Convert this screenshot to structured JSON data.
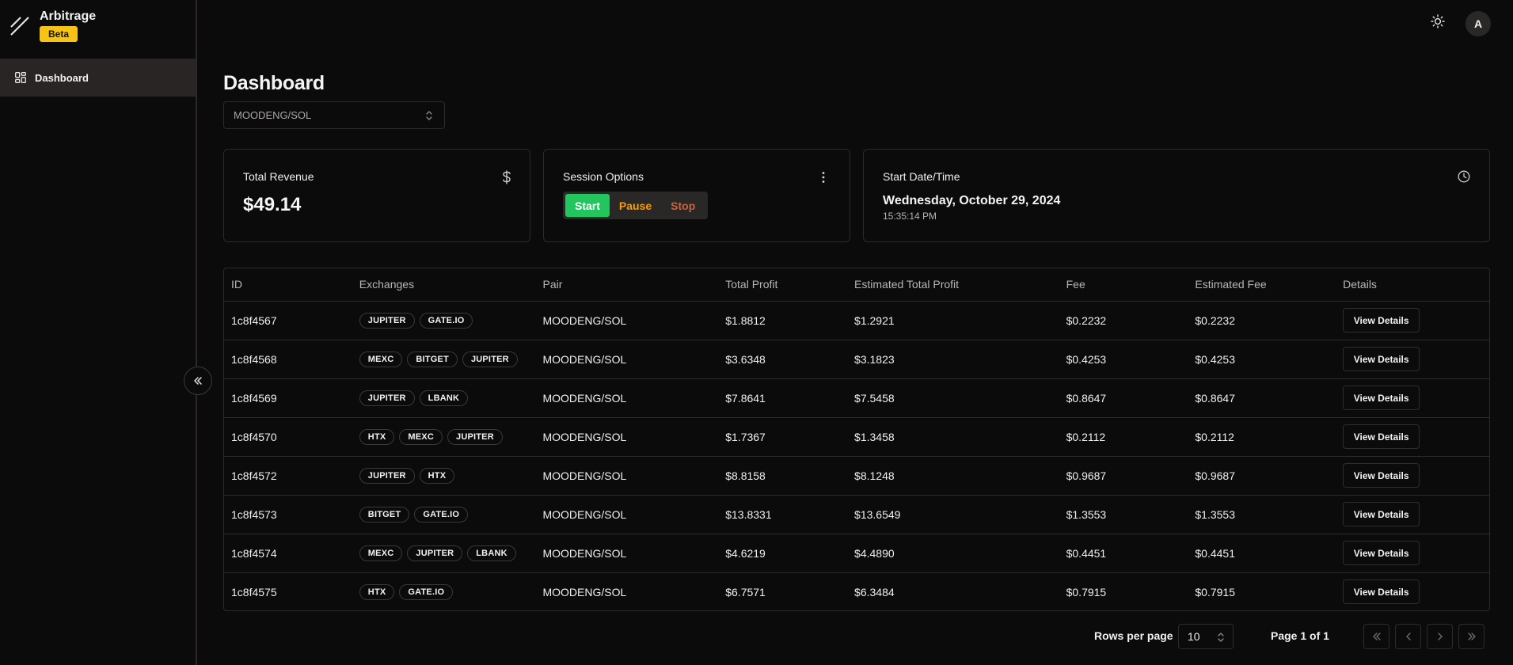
{
  "brand": {
    "title": "Arbitrage",
    "badge": "Beta"
  },
  "sidebar": {
    "items": [
      {
        "label": "Dashboard",
        "icon": "dashboard-icon"
      }
    ]
  },
  "header": {
    "avatar_initial": "A"
  },
  "page": {
    "title": "Dashboard",
    "pair_selected": "MOODENG/SOL"
  },
  "cards": {
    "revenue": {
      "title": "Total Revenue",
      "value": "$49.14",
      "icon": "dollar-icon"
    },
    "session": {
      "title": "Session Options",
      "start": "Start",
      "pause": "Pause",
      "stop": "Stop",
      "icon": "more-vertical-icon"
    },
    "start_date": {
      "title": "Start Date/Time",
      "date": "Wednesday, October 29, 2024",
      "time": "15:35:14 PM",
      "icon": "clock-icon"
    }
  },
  "table": {
    "columns": [
      "ID",
      "Exchanges",
      "Pair",
      "Total Profit",
      "Estimated Total Profit",
      "Fee",
      "Estimated Fee",
      "Details"
    ],
    "details_label": "View Details",
    "rows": [
      {
        "id": "1c8f4567",
        "exchanges": [
          "JUPITER",
          "GATE.IO"
        ],
        "pair": "MOODENG/SOL",
        "total_profit": "$1.8812",
        "est_total_profit": "$1.2921",
        "fee": "$0.2232",
        "est_fee": "$0.2232"
      },
      {
        "id": "1c8f4568",
        "exchanges": [
          "MEXC",
          "BITGET",
          "JUPITER"
        ],
        "pair": "MOODENG/SOL",
        "total_profit": "$3.6348",
        "est_total_profit": "$3.1823",
        "fee": "$0.4253",
        "est_fee": "$0.4253"
      },
      {
        "id": "1c8f4569",
        "exchanges": [
          "JUPITER",
          "LBANK"
        ],
        "pair": "MOODENG/SOL",
        "total_profit": "$7.8641",
        "est_total_profit": "$7.5458",
        "fee": "$0.8647",
        "est_fee": "$0.8647"
      },
      {
        "id": "1c8f4570",
        "exchanges": [
          "HTX",
          "MEXC",
          "JUPITER"
        ],
        "pair": "MOODENG/SOL",
        "total_profit": "$1.7367",
        "est_total_profit": "$1.3458",
        "fee": "$0.2112",
        "est_fee": "$0.2112"
      },
      {
        "id": "1c8f4572",
        "exchanges": [
          "JUPITER",
          "HTX"
        ],
        "pair": "MOODENG/SOL",
        "total_profit": "$8.8158",
        "est_total_profit": "$8.1248",
        "fee": "$0.9687",
        "est_fee": "$0.9687"
      },
      {
        "id": "1c8f4573",
        "exchanges": [
          "BITGET",
          "GATE.IO"
        ],
        "pair": "MOODENG/SOL",
        "total_profit": "$13.8331",
        "est_total_profit": "$13.6549",
        "fee": "$1.3553",
        "est_fee": "$1.3553"
      },
      {
        "id": "1c8f4574",
        "exchanges": [
          "MEXC",
          "JUPITER",
          "LBANK"
        ],
        "pair": "MOODENG/SOL",
        "total_profit": "$4.6219",
        "est_total_profit": "$4.4890",
        "fee": "$0.4451",
        "est_fee": "$0.4451"
      },
      {
        "id": "1c8f4575",
        "exchanges": [
          "HTX",
          "GATE.IO"
        ],
        "pair": "MOODENG/SOL",
        "total_profit": "$6.7571",
        "est_total_profit": "$6.3484",
        "fee": "$0.7915",
        "est_fee": "$0.7915"
      }
    ]
  },
  "pagination": {
    "rows_label": "Rows per page",
    "rows_value": "10",
    "page_label": "Page 1 of 1"
  },
  "colors": {
    "accent_start": "#22c55e",
    "accent_pause": "#f59e0b",
    "accent_stop": "#c8643c",
    "badge": "#f5c416"
  }
}
